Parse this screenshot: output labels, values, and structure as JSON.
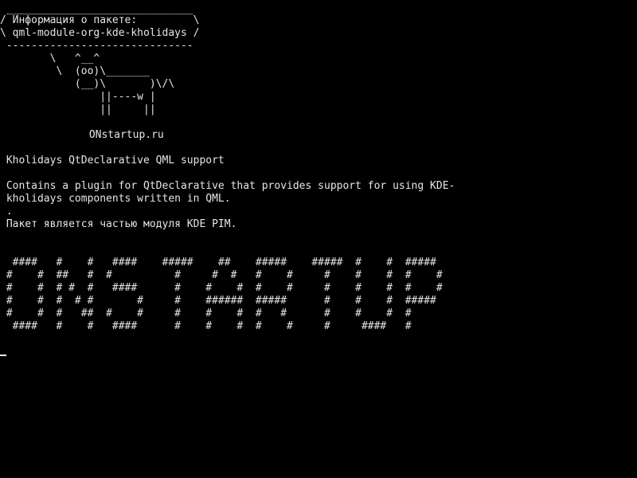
{
  "cowsay": {
    "bubble_top": " ______________________________",
    "bubble_line1": "/ Информация о пакете:         \\",
    "bubble_line2": "\\ qml-module-org-kde-kholidays /",
    "bubble_bottom": " ------------------------------",
    "cow_line1": "        \\   ^__^",
    "cow_line2": "         \\  (oo)\\_______",
    "cow_line3": "            (__)\\       )\\/\\",
    "cow_line4": "                ||----w |",
    "cow_line5": "                ||     ||"
  },
  "site": " ONstartup.ru",
  "package": {
    "summary": " Kholidays QtDeclarative QML support",
    "description_line1": " Contains a plugin for QtDeclarative that provides support for using KDE-",
    "description_line2": " kholidays components written in QML.",
    "dot": " .",
    "part_of": " Пакет является частью модуля KDE PIM."
  },
  "banner": {
    "line1": "  ####   #    #   ####    #####    ##    #####    #####  #    #  #####",
    "line2": " #    #  ##   #  #          #     #  #   #    #     #    #    #  #    #",
    "line3": " #    #  # #  #   ####      #    #    #  #    #     #    #    #  #    #",
    "line4": " #    #  #  # #       #     #    ######  #####      #    #    #  #####",
    "line5": " #    #  #   ##  #    #     #    #    #  #   #      #    #    #  #",
    "line6": "  ####   #    #   ####      #    #    #  #    #     #     ####   #"
  }
}
